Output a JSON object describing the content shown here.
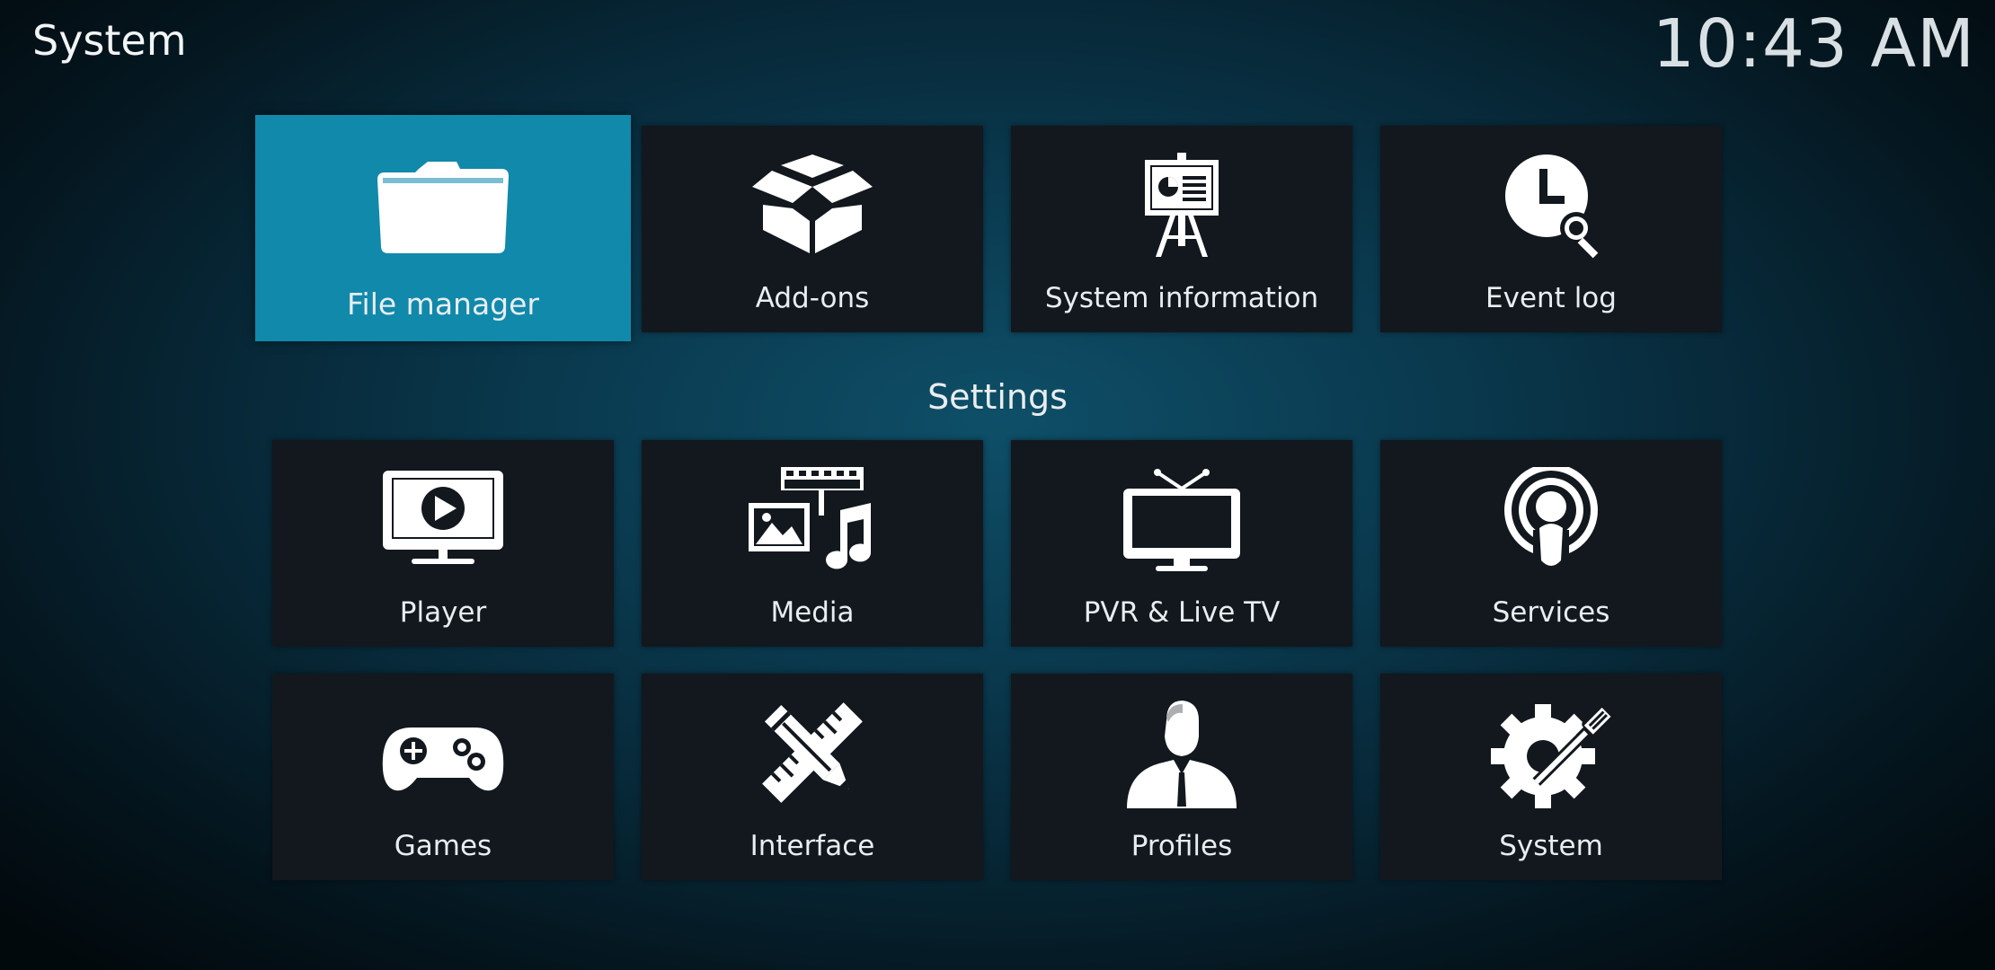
{
  "header": {
    "title": "System",
    "clock": "10:43 AM"
  },
  "top_row": [
    {
      "label": "File manager",
      "icon": "folder-icon",
      "focused": true
    },
    {
      "label": "Add-ons",
      "icon": "box-icon"
    },
    {
      "label": "System information",
      "icon": "presentation-icon"
    },
    {
      "label": "Event log",
      "icon": "clock-search-icon"
    }
  ],
  "settings": {
    "title": "Settings",
    "row1": [
      {
        "label": "Player",
        "icon": "monitor-play-icon"
      },
      {
        "label": "Media",
        "icon": "media-icon"
      },
      {
        "label": "PVR & Live TV",
        "icon": "tv-icon"
      },
      {
        "label": "Services",
        "icon": "podcast-icon"
      }
    ],
    "row2": [
      {
        "label": "Games",
        "icon": "gamepad-icon"
      },
      {
        "label": "Interface",
        "icon": "pencil-ruler-icon"
      },
      {
        "label": "Profiles",
        "icon": "person-icon"
      },
      {
        "label": "System",
        "icon": "gear-wrench-icon"
      }
    ]
  },
  "colors": {
    "focus": "#1189ab",
    "tile": "#12181e"
  }
}
